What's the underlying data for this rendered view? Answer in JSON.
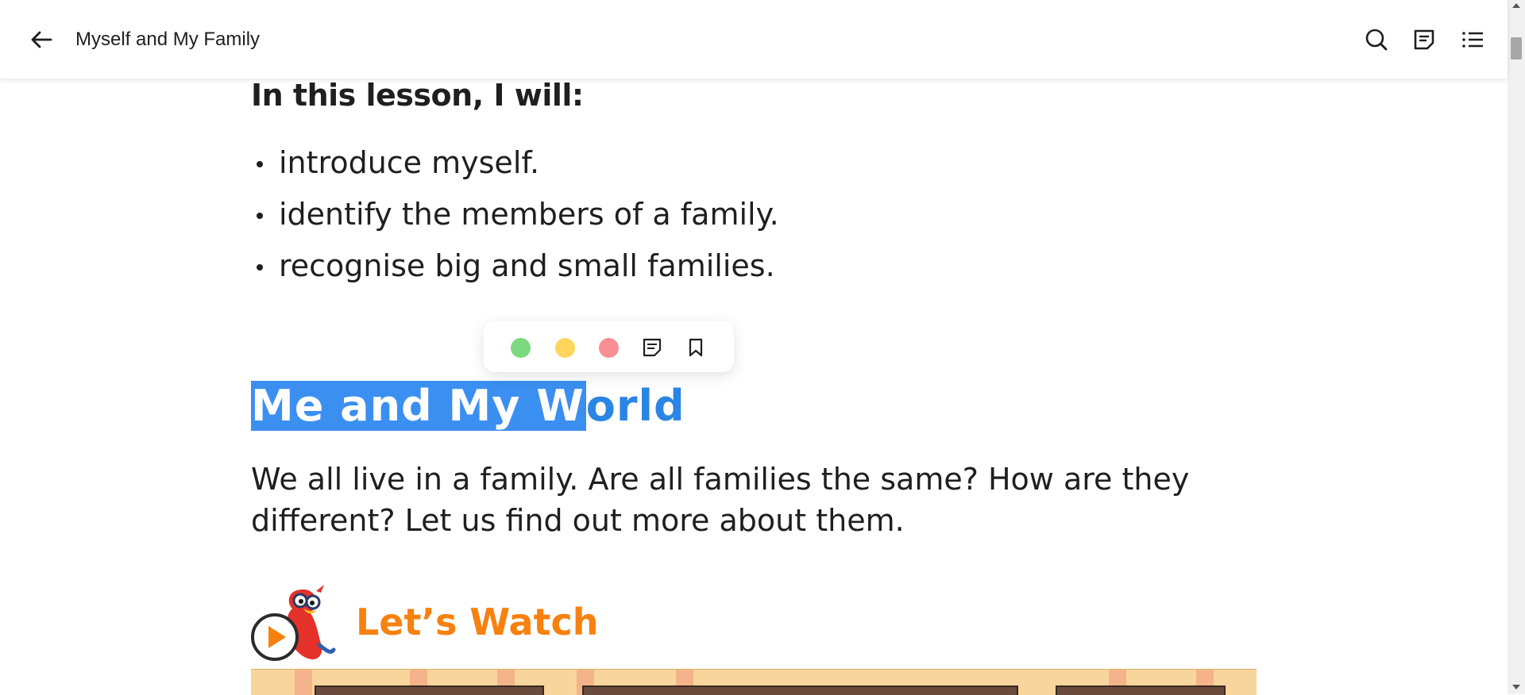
{
  "header": {
    "title": "Myself and My Family",
    "back_icon": "arrow-left-icon",
    "tools": [
      {
        "name": "search",
        "icon": "search-icon"
      },
      {
        "name": "notes",
        "icon": "notes-icon"
      },
      {
        "name": "contents",
        "icon": "list-icon"
      }
    ]
  },
  "lesson": {
    "heading": "In this lesson, I will:",
    "goals": [
      "introduce myself.",
      "identify the members of a family.",
      "recognise big and small families."
    ]
  },
  "highlight_popup": {
    "colors": [
      "#7dd97f",
      "#ffd55c",
      "#f98f95"
    ],
    "icons": [
      "add-note-icon",
      "bookmark-icon"
    ]
  },
  "section": {
    "title_selected": "Me and My W",
    "title_rest": "orld",
    "title_color": "#2b85e4",
    "selection_color": "#3b8ff0",
    "intro": "We all live in a family. Are all families the same? How are they different? Let us find out more about them."
  },
  "watch": {
    "label": "Let’s Watch",
    "label_color": "#f7810f",
    "mascot": "parrot-mascot-with-play-icon"
  }
}
